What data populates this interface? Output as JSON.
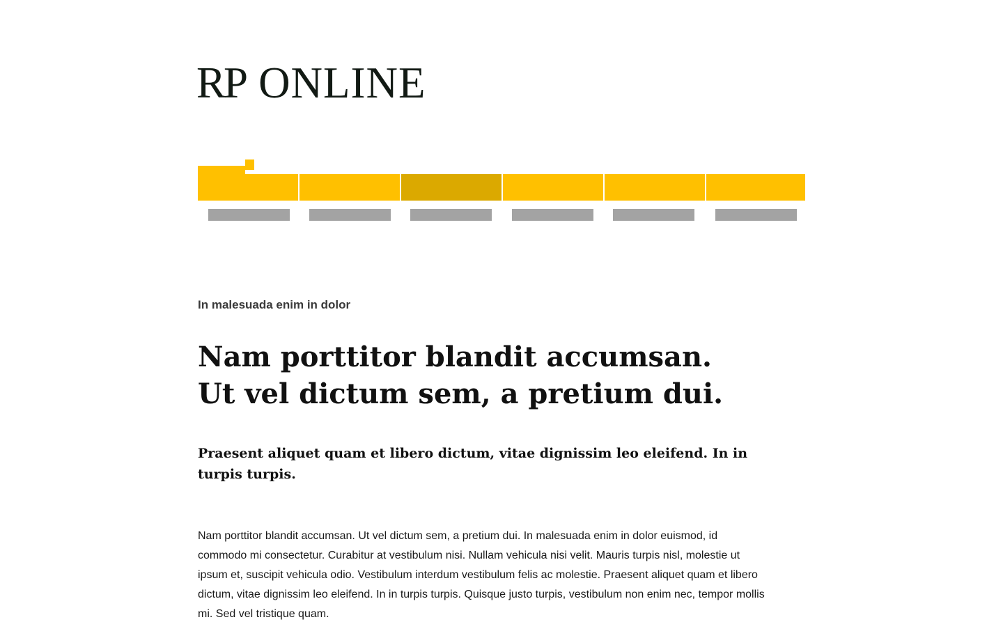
{
  "brand": {
    "logo_rp": "RP",
    "logo_online": "ONLINE",
    "accent_color": "#ffc000",
    "active_color": "#dba900"
  },
  "nav": {
    "tabs": [
      {
        "label": ""
      },
      {
        "label": ""
      },
      {
        "label": ""
      },
      {
        "label": ""
      },
      {
        "label": ""
      },
      {
        "label": ""
      }
    ],
    "active_index": 2
  },
  "article": {
    "kicker": "In malesuada enim in dolor",
    "headline_line1": "Nam porttitor blandit accumsan.",
    "headline_line2": "Ut vel dictum sem, a pretium dui.",
    "teaser": "Praesent aliquet quam et libero dictum, vitae dignissim leo eleifend. In in turpis turpis.",
    "body": "Nam porttitor blandit accumsan. Ut vel dictum sem, a pretium dui. In malesuada enim in dolor euismod, id commodo mi consectetur. Curabitur at vestibulum nisi. Nullam vehicula nisi velit. Mauris turpis nisl, molestie ut ipsum et, suscipit vehicula odio. Vestibulum interdum vestibulum felis ac molestie. Praesent aliquet quam et libero dictum, vitae dignissim leo eleifend. In in turpis turpis. Quisque justo turpis, vestibulum non enim nec, tempor mollis mi. Sed vel tristique quam."
  }
}
